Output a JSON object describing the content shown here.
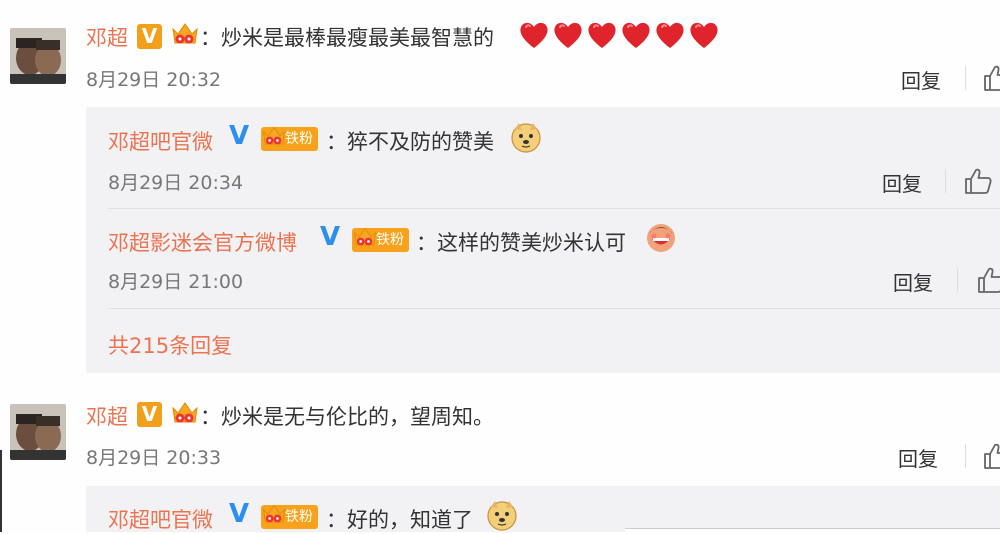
{
  "comments": [
    {
      "author": "邓超",
      "text": "：炒米是最棒最瘦最美最智慧的",
      "hearts": 6,
      "time": "8月29日 20:32",
      "reply_label": "回复",
      "replies": [
        {
          "author": "邓超吧官微",
          "badge": "铁粉",
          "text": "：猝不及防的赞美",
          "emoji": "doge-icon",
          "time": "8月29日 20:34",
          "reply_label": "回复"
        },
        {
          "author": "邓超影迷会官方微博",
          "badge": "铁粉",
          "text": "：这样的赞美炒米认可",
          "emoji": "blush-face-icon",
          "time": "8月29日 21:00",
          "reply_label": "回复"
        }
      ],
      "more_replies": "共215条回复"
    },
    {
      "author": "邓超",
      "text": "：炒米是无与伦比的，望周知。",
      "time": "8月29日 20:33",
      "reply_label": "回复",
      "replies": [
        {
          "author": "邓超吧官微",
          "badge": "铁粉",
          "text": "：好的，知道了",
          "emoji": "doge-icon"
        }
      ]
    }
  ],
  "colors": {
    "name": "#eb7350",
    "reply_bg": "#f2f2f5",
    "vip_blue": "#2b8ff0",
    "vip_orange": "#f2a01a"
  }
}
